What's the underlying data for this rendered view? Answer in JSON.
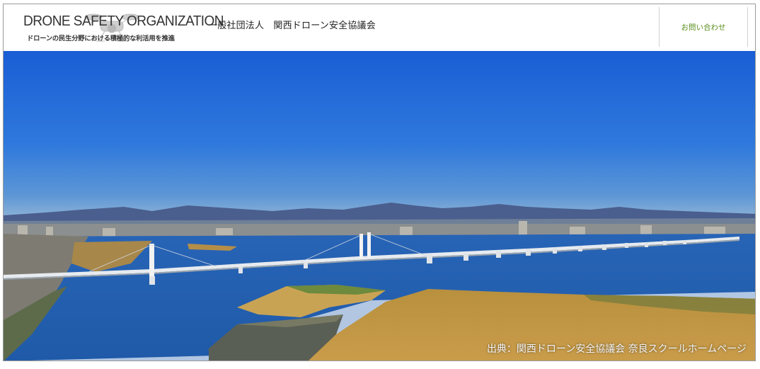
{
  "header": {
    "logo_title": "DRONE SAFETY ORGANIZATION",
    "logo_tagline": "ドローンの民生分野における積極的な利活用を推進",
    "org_name": "一般社団法人　関西ドローン安全協議会",
    "contact_label": "お問い合わせ"
  },
  "hero": {
    "credit": "出典：関西ドローン安全協議会 奈良スクールホームページ"
  },
  "colors": {
    "accent_green": "#5a8e1e",
    "sky_top": "#1b5fd4",
    "sky_bottom": "#7aa9d8",
    "water": "#2f67b8"
  }
}
